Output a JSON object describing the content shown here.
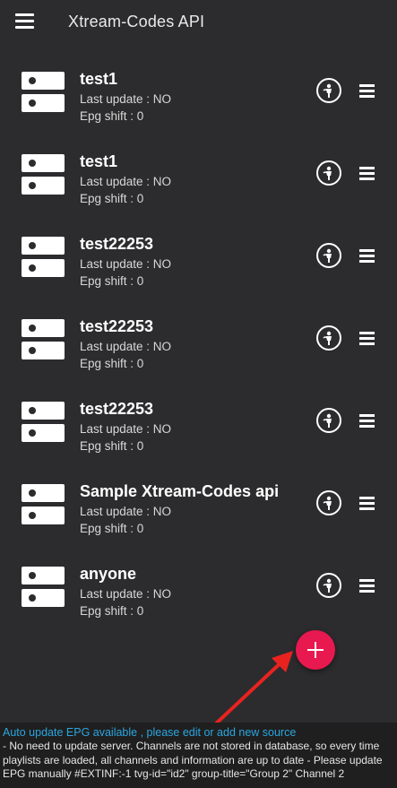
{
  "appbar": {
    "title": "Xtream-Codes API",
    "menu_icon": "hamburger-menu-icon"
  },
  "sources": [
    {
      "name": "test1",
      "last_update": "Last update : NO",
      "epg_shift": "Epg shift : 0"
    },
    {
      "name": "test1",
      "last_update": "Last update : NO",
      "epg_shift": "Epg shift : 0"
    },
    {
      "name": "test22253",
      "last_update": "Last update : NO",
      "epg_shift": "Epg shift : 0"
    },
    {
      "name": "test22253",
      "last_update": "Last update : NO",
      "epg_shift": "Epg shift : 0"
    },
    {
      "name": "test22253",
      "last_update": "Last update : NO",
      "epg_shift": "Epg shift : 0"
    },
    {
      "name": "Sample Xtream-Codes api",
      "last_update": "Last update : NO",
      "epg_shift": "Epg shift : 0"
    },
    {
      "name": "anyone",
      "last_update": "Last update : NO",
      "epg_shift": "Epg shift : 0"
    }
  ],
  "fab": {
    "icon": "plus-icon",
    "color": "#e8194f"
  },
  "footer": {
    "link": "Auto update EPG available , please edit or add new source",
    "description": "- No need to update server. Channels are not stored in database, so every time playlists are loaded, all channels and information are up to date - Please update EPG manually #EXTINF:-1 tvg-id=\"id2\" group-title=\"Group 2\" Channel 2"
  },
  "colors": {
    "background": "#2c2c2e",
    "footer_bg": "#1f1f1f",
    "link": "#2aa6e0",
    "accent": "#e8194f",
    "arrow": "#e8231f"
  }
}
